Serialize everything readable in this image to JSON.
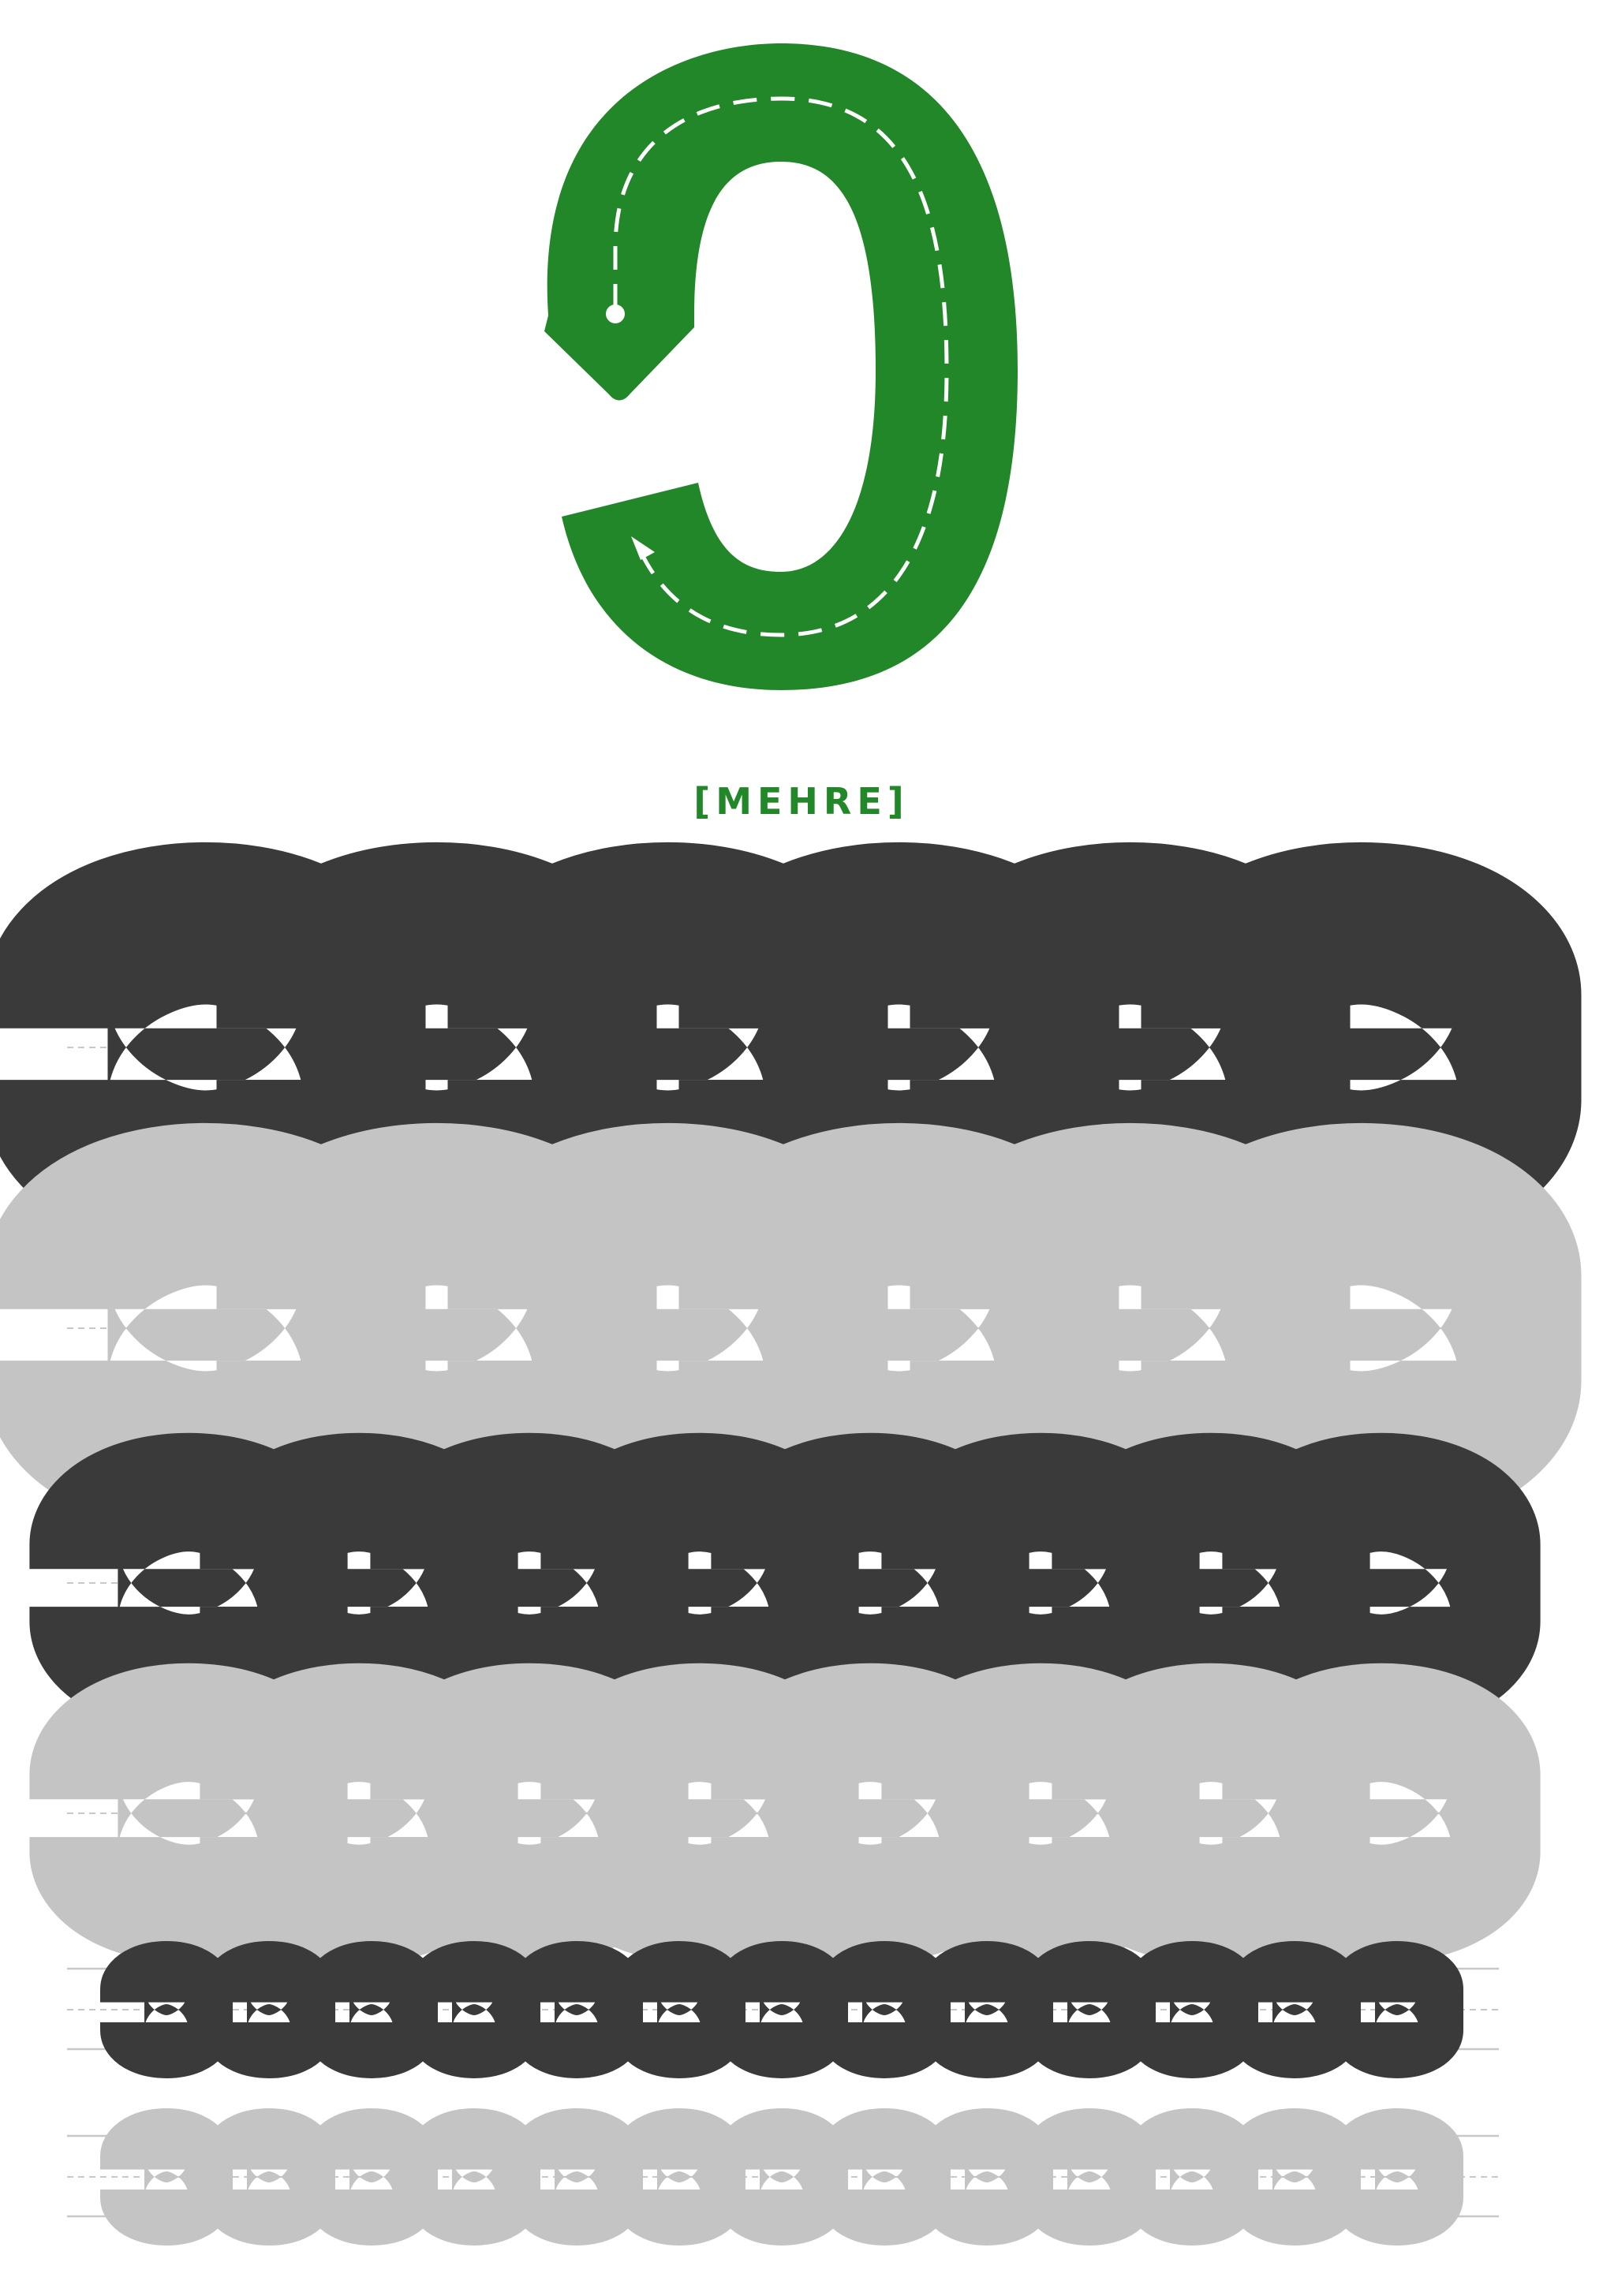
{
  "worksheet": {
    "letter_name": "[MEHRE]",
    "colors": {
      "accent": "#228729",
      "road_dash": "#ffffff",
      "guide_line": "#c8c8c8",
      "trace_dark": "#3a3a3a",
      "trace_light": "#c4c4c4"
    },
    "icons": {
      "main_letter": "green-road-letter-icon",
      "start_point": "start-dot-icon",
      "direction": "direction-arrow-icon"
    },
    "practice_rows": [
      {
        "size": "large",
        "shade": "dark",
        "letter_count": 6
      },
      {
        "size": "large",
        "shade": "light",
        "letter_count": 6
      },
      {
        "size": "medium",
        "shade": "dark",
        "letter_count": 8
      },
      {
        "size": "medium",
        "shade": "light",
        "letter_count": 8
      },
      {
        "size": "small",
        "shade": "dark",
        "letter_count": 13
      },
      {
        "size": "small",
        "shade": "light",
        "letter_count": 13
      }
    ]
  }
}
